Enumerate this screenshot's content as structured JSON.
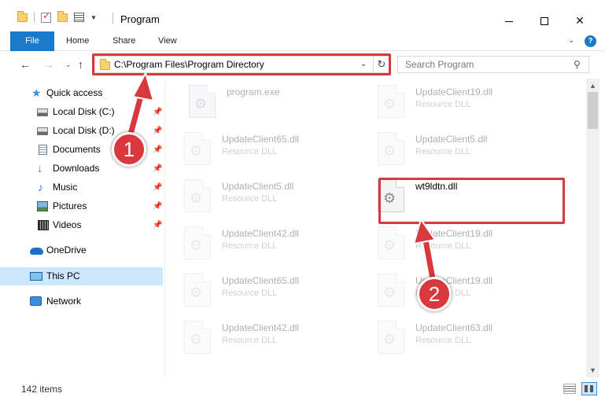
{
  "window": {
    "title": "Program"
  },
  "ribbon": {
    "tabs": [
      {
        "label": "File"
      },
      {
        "label": "Home"
      },
      {
        "label": "Share"
      },
      {
        "label": "View"
      }
    ],
    "help_glyph": "?"
  },
  "address_bar": {
    "path": "C:\\Program Files\\Program Directory",
    "refresh_glyph": "↻"
  },
  "search": {
    "placeholder": "Search Program"
  },
  "nav_pane": {
    "items": [
      {
        "label": "Quick access",
        "icon": "star-icon"
      },
      {
        "label": "Local Disk (C:)",
        "icon": "disk-icon",
        "pinned": true
      },
      {
        "label": "Local Disk (D:)",
        "icon": "disk-icon",
        "pinned": true
      },
      {
        "label": "Documents",
        "icon": "documents-icon",
        "pinned": true
      },
      {
        "label": "Downloads",
        "icon": "downloads-icon",
        "pinned": true
      },
      {
        "label": "Music",
        "icon": "music-icon",
        "pinned": true
      },
      {
        "label": "Pictures",
        "icon": "pictures-icon",
        "pinned": true
      },
      {
        "label": "Videos",
        "icon": "videos-icon",
        "pinned": true
      },
      {
        "label": "OneDrive",
        "icon": "onedrive-icon"
      },
      {
        "label": "This PC",
        "icon": "this-pc-icon",
        "selected": true
      },
      {
        "label": "Network",
        "icon": "network-icon"
      }
    ]
  },
  "files": [
    {
      "name": "program.exe",
      "type": ""
    },
    {
      "name": "UpdateClient19.dll",
      "type": "Resource DLL"
    },
    {
      "name": "UpdateClient65.dll",
      "type": "Resource DLL"
    },
    {
      "name": "UpdateClient5.dll",
      "type": "Resource DLL"
    },
    {
      "name": "UpdateClient5.dll",
      "type": "Resource DLL"
    },
    {
      "name": "wt9ldtn.dll",
      "type": "",
      "highlighted": true
    },
    {
      "name": "UpdateClient42.dll",
      "type": "Resource DLL"
    },
    {
      "name": "UpdateClient19.dll",
      "type": "Resource DLL"
    },
    {
      "name": "UpdateClient65.dll",
      "type": "Resource DLL"
    },
    {
      "name": "UpdateClient19.dll",
      "type": "Resource DLL"
    },
    {
      "name": "UpdateClient42.dll",
      "type": "Resource DLL"
    },
    {
      "name": "UpdateClient63.dll",
      "type": "Resource DLL"
    }
  ],
  "status": {
    "item_count": "142 items"
  },
  "annotations": {
    "step1": "1",
    "step2": "2",
    "color": "#d9383d"
  }
}
